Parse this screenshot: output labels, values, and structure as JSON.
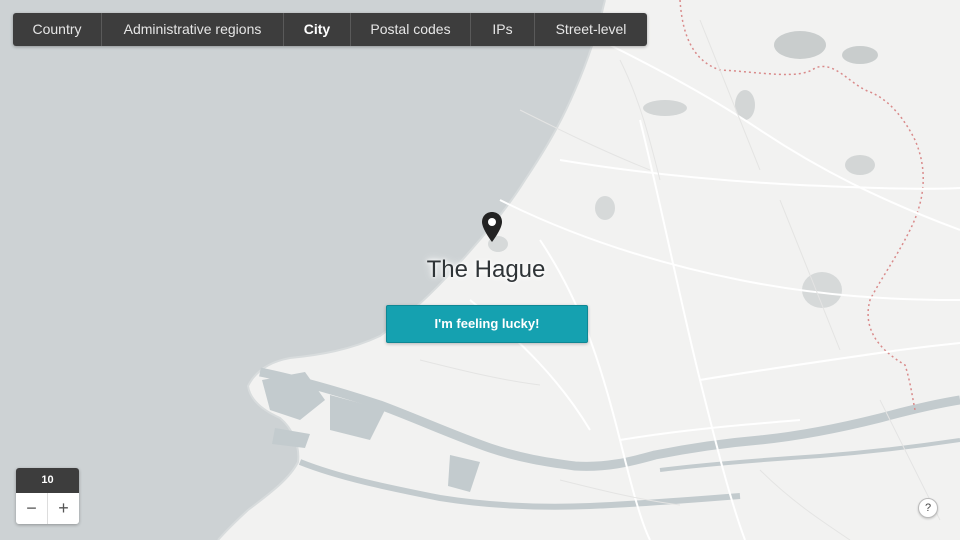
{
  "tabs": [
    {
      "label": "Country",
      "active": false
    },
    {
      "label": "Administrative regions",
      "active": false
    },
    {
      "label": "City",
      "active": true
    },
    {
      "label": "Postal codes",
      "active": false
    },
    {
      "label": "IPs",
      "active": false
    },
    {
      "label": "Street-level",
      "active": false
    }
  ],
  "map": {
    "city_name": "The Hague",
    "marker_icon": "map-pin-icon",
    "colors": {
      "land": "#f2f2f1",
      "sea": "#cdd2d4",
      "water": "#c3cbce",
      "border": "#d98a8a"
    }
  },
  "lucky_button": {
    "label": "I'm feeling lucky!",
    "color": "#15a1b0"
  },
  "zoom": {
    "level": "10",
    "minus_symbol": "−",
    "plus_symbol": "+"
  },
  "help": {
    "symbol": "?"
  }
}
